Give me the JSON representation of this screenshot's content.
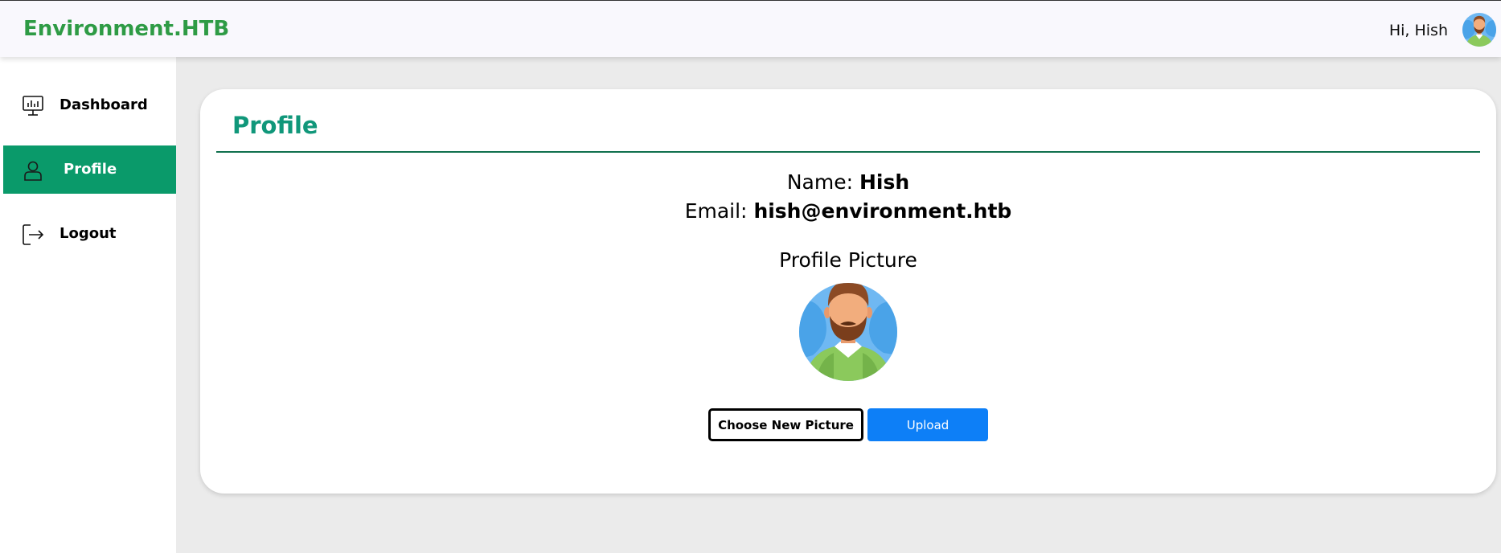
{
  "header": {
    "brand": "Environment.HTB",
    "greeting": "Hi, Hish",
    "avatar_icon": "user-avatar-icon"
  },
  "sidebar": {
    "items": [
      {
        "label": "Dashboard",
        "icon": "dashboard-monitor-icon",
        "active": false
      },
      {
        "label": "Profile",
        "icon": "user-icon",
        "active": true
      },
      {
        "label": "Logout",
        "icon": "logout-icon",
        "active": false
      }
    ]
  },
  "profile": {
    "title": "Profile",
    "name_label": "Name:",
    "name_value": "Hish",
    "email_label": "Email:",
    "email_value": "hish@environment.htb",
    "picture_label": "Profile Picture",
    "choose_button": "Choose New Picture",
    "upload_button": "Upload"
  },
  "colors": {
    "brand": "#2e9b45",
    "active_nav": "#0a9a6a",
    "title": "#10977a",
    "upload_button": "#0d7ff7"
  }
}
